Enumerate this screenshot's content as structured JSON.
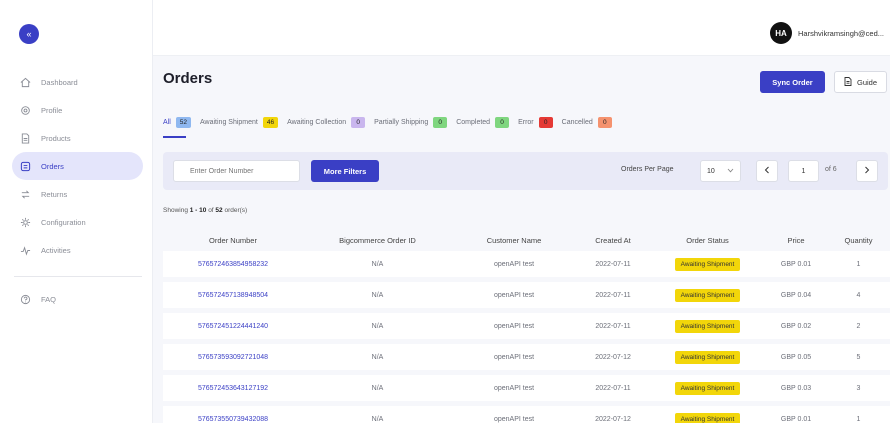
{
  "sidebar": {
    "items": [
      {
        "label": "Dashboard",
        "icon": "home-icon"
      },
      {
        "label": "Profile",
        "icon": "gear-icon"
      },
      {
        "label": "Products",
        "icon": "file-icon"
      },
      {
        "label": "Orders",
        "icon": "orders-icon"
      },
      {
        "label": "Returns",
        "icon": "returns-icon"
      },
      {
        "label": "Configuration",
        "icon": "cog-icon"
      },
      {
        "label": "Activities",
        "icon": "activity-icon"
      }
    ],
    "faq_label": "FAQ",
    "active": "Orders",
    "accent": "#3a3fc5"
  },
  "header": {
    "avatar_initials": "HA",
    "user_name": "Harshvikramsingh@ced..."
  },
  "page": {
    "title": "Orders",
    "sync_label": "Sync Order",
    "guide_label": "Guide"
  },
  "tabs": [
    {
      "label": "All",
      "count": "52",
      "color": "#8fb8f0"
    },
    {
      "label": "Awaiting Shipment",
      "count": "46",
      "color": "#f2d60a"
    },
    {
      "label": "Awaiting Collection",
      "count": "0",
      "color": "#c9b6ee"
    },
    {
      "label": "Partially Shipping",
      "count": "0",
      "color": "#7fd67f"
    },
    {
      "label": "Completed",
      "count": "0",
      "color": "#7fd67f"
    },
    {
      "label": "Error",
      "count": "0",
      "color": "#e53935"
    },
    {
      "label": "Cancelled",
      "count": "0",
      "color": "#f5926e"
    }
  ],
  "filters": {
    "search_placeholder": "Enter Order Number",
    "more_filters_label": "More Filters",
    "per_page_label": "Orders Per Page",
    "per_page_value": "10",
    "page_value": "1",
    "page_of": "of 6"
  },
  "showing": {
    "prefix": "Showing",
    "range": "1 - 10",
    "of": "of",
    "total": "52",
    "suffix": "order(s)"
  },
  "table": {
    "columns": [
      "Order Number",
      "Bigcommerce Order ID",
      "Customer Name",
      "Created At",
      "Order Status",
      "Price",
      "Quantity"
    ],
    "rows": [
      [
        "576572463854958232",
        "N/A",
        "openAPI test",
        "2022-07-11",
        "Awaiting Shipment",
        "GBP 0.01",
        "1"
      ],
      [
        "576572457138948504",
        "N/A",
        "openAPI test",
        "2022-07-11",
        "Awaiting Shipment",
        "GBP 0.04",
        "4"
      ],
      [
        "576572451224441240",
        "N/A",
        "openAPI test",
        "2022-07-11",
        "Awaiting Shipment",
        "GBP 0.02",
        "2"
      ],
      [
        "576573593092721048",
        "N/A",
        "openAPI test",
        "2022-07-12",
        "Awaiting Shipment",
        "GBP 0.05",
        "5"
      ],
      [
        "576572453643127192",
        "N/A",
        "openAPI test",
        "2022-07-11",
        "Awaiting Shipment",
        "GBP 0.03",
        "3"
      ],
      [
        "576573550739432088",
        "N/A",
        "openAPI test",
        "2022-07-12",
        "Awaiting Shipment",
        "GBP 0.01",
        "1"
      ]
    ]
  }
}
